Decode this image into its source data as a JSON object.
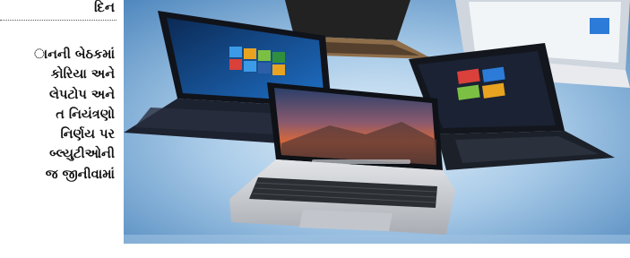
{
  "article": {
    "section_heading": "દિન",
    "body_lines": [
      "ાનની બેઠકમાં",
      "કોરિયા અને",
      "લેપટોપ અને",
      "ત નિયંત્રણો",
      "નિર્ણય પર",
      "બ્લ્યુટીઓની",
      "જ જીનીવામાં"
    ]
  },
  "photo": {
    "subject": "laptops-arranged-on-blue-background",
    "colors": {
      "background": "#6fa3cf",
      "background_light": "#cfe3f3",
      "silver_body": "#c9ccd1",
      "dark_body": "#1d2230",
      "windows_blue": "#1f6fc5",
      "mac_orange": "#d9683a"
    }
  }
}
